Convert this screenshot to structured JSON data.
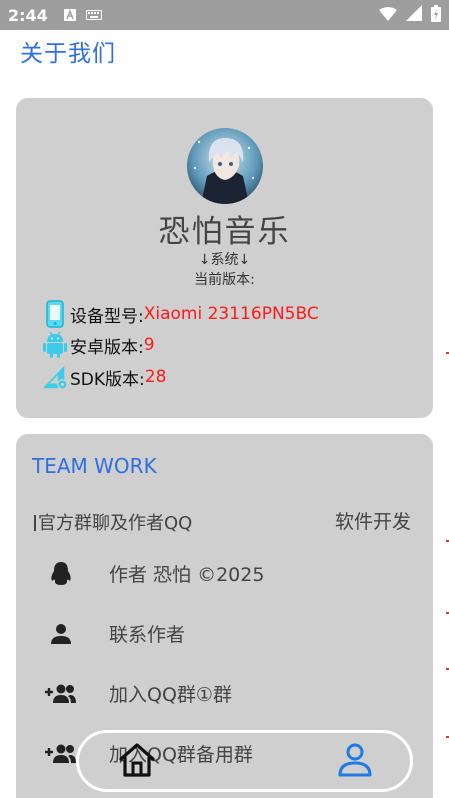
{
  "status_bar": {
    "time": "2:44",
    "icons": [
      "a-icon",
      "keyboard-icon",
      "wifi-icon",
      "signal-icon",
      "battery-icon"
    ]
  },
  "page": {
    "title": "关于我们"
  },
  "app_card": {
    "name": "恐怕音乐",
    "system_label": "↓系统↓",
    "version_label": "当前版本:",
    "device": {
      "label": "设备型号:",
      "value": "Xiaomi 23116PN5BC",
      "icon": "phone-icon"
    },
    "android": {
      "label": "安卓版本:",
      "value": "9",
      "icon": "android-icon"
    },
    "sdk": {
      "label": "SDK版本:",
      "value": "28",
      "icon": "ruler-gear-icon"
    }
  },
  "team_card": {
    "title": "TEAM WORK",
    "subhead_left": "官方群聊及作者QQ",
    "subhead_right": "软件开发",
    "rows": [
      {
        "label": "作者  恐怕 ©2025",
        "icon": "qq-penguin-icon"
      },
      {
        "label": "联系作者",
        "icon": "person-icon"
      },
      {
        "label": "加入QQ群①群",
        "icon": "group-add-icon"
      },
      {
        "label": "加入QQ群备用群",
        "icon": "group-add-icon"
      }
    ]
  },
  "bottom_nav": {
    "items": [
      {
        "name": "home",
        "icon": "home-icon"
      },
      {
        "name": "profile",
        "icon": "person-icon"
      }
    ]
  },
  "colors": {
    "accent": "#2f6fe0",
    "value_red": "#ff1a1a",
    "card_bg": "#cfcfcf",
    "status_bar": "#9e9e9e",
    "profile_blue": "#1e7be6"
  }
}
